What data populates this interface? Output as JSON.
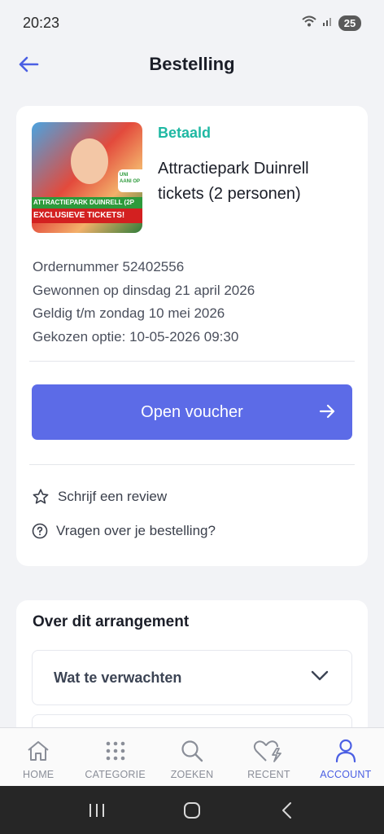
{
  "status_bar": {
    "time": "20:23",
    "battery": "25"
  },
  "header": {
    "title": "Bestelling"
  },
  "order": {
    "status": "Betaald",
    "title": "Attractiepark Duinrell tickets (2 personen)",
    "image": {
      "banner_top": "ATTRACTIEPARK DUINRELL (2P",
      "banner_bottom": "EXCLUSIEVE TICKETS!",
      "badge": "UNI AANI OP"
    },
    "details": [
      "Ordernummer 52402556",
      "Gewonnen op dinsdag 21 april 2026",
      "Geldig t/m zondag 10 mei 2026",
      "Gekozen optie: 10-05-2026 09:30"
    ],
    "voucher_button": "Open voucher",
    "review_link": "Schrijf een review",
    "questions_link": "Vragen over je bestelling?"
  },
  "arrangement": {
    "title": "Over dit arrangement",
    "accordion": "Wat te verwachten"
  },
  "bottom_nav": [
    {
      "label": "HOME",
      "icon": "home-icon"
    },
    {
      "label": "CATEGORIE",
      "icon": "grid-icon"
    },
    {
      "label": "ZOEKEN",
      "icon": "search-icon"
    },
    {
      "label": "RECENT",
      "icon": "heart-bolt-icon"
    },
    {
      "label": "ACCOUNT",
      "icon": "user-icon",
      "active": true
    }
  ],
  "colors": {
    "accent": "#5c6be7",
    "paid": "#1fb8a3",
    "nav_active": "#4b5fe3"
  }
}
